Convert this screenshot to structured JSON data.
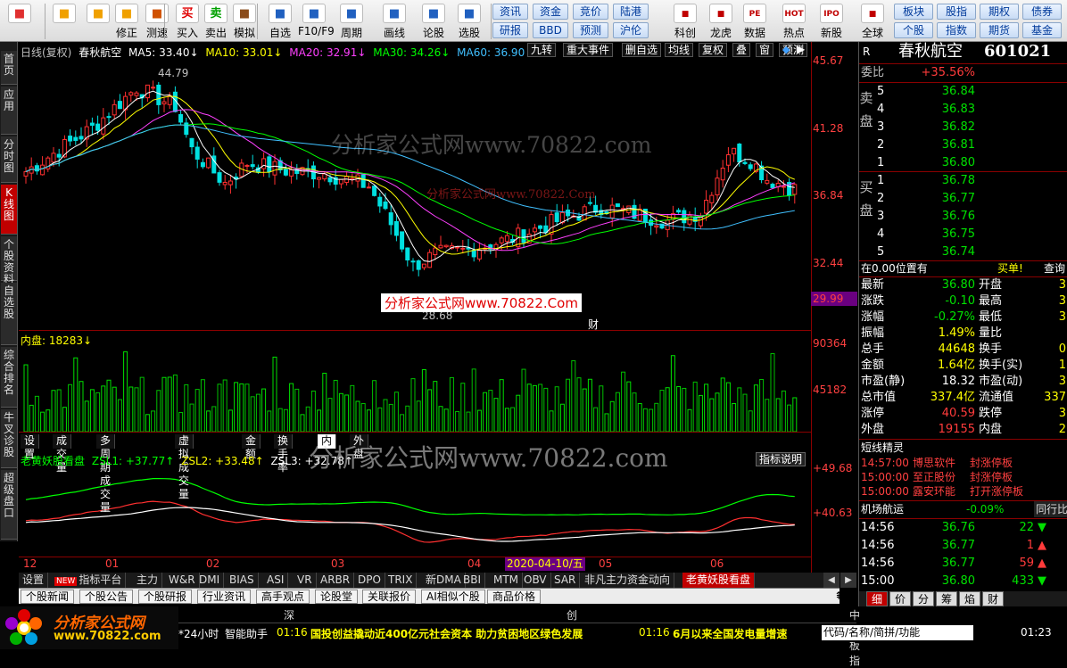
{
  "toolbar": {
    "left_tools": [
      {
        "label": "",
        "icon": "grid-icon"
      },
      {
        "label": "",
        "icon": "back-arrow-icon"
      },
      {
        "label": "",
        "icon": "up-down-arrows-icon"
      },
      {
        "label": "修正",
        "icon": "bell-icon"
      },
      {
        "label": "测速",
        "icon": "clock-icon"
      },
      {
        "label": "买入",
        "icon": "buy-icon",
        "glyph": "买"
      },
      {
        "label": "卖出",
        "icon": "sell-icon",
        "glyph": "卖"
      },
      {
        "label": "模拟",
        "icon": "hammer-icon"
      },
      {
        "label": "自选",
        "icon": "star-icon"
      },
      {
        "label": "F10/F9",
        "icon": "f10-icon"
      },
      {
        "label": "周期",
        "icon": "period-icon"
      },
      {
        "label": "画线",
        "icon": "pencil-icon"
      },
      {
        "label": "论股",
        "icon": "forum-icon"
      },
      {
        "label": "选股",
        "icon": "select-stock-icon"
      }
    ],
    "blue_buttons": [
      [
        "资讯",
        "资金",
        "竞价",
        "陆港"
      ],
      [
        "研报",
        "BBD",
        "预测",
        "沪伦"
      ]
    ],
    "right_tools": [
      {
        "label": "科创",
        "icon": "kechuang-icon"
      },
      {
        "label": "龙虎",
        "icon": "dragon-tiger-icon"
      },
      {
        "label": "数据",
        "icon": "pe-data-icon",
        "glyph": "PE"
      },
      {
        "label": "热点",
        "icon": "hot-icon",
        "glyph": "HOT"
      },
      {
        "label": "新股",
        "icon": "ipo-icon",
        "glyph": "IPO"
      },
      {
        "label": "全球",
        "icon": "globe-icon"
      }
    ],
    "right_buttons": [
      [
        "板块",
        "股指",
        "期权",
        "债券"
      ],
      [
        "个股",
        "指数",
        "期货",
        "基金"
      ]
    ]
  },
  "left_tabs": [
    "首页",
    "应用",
    "分时图",
    "K线图",
    "个股资料",
    "自选股",
    "综合排名",
    "牛叉诊股",
    "超级盘口"
  ],
  "chart": {
    "header": {
      "period": "日线(复权)",
      "name": "春秋航空",
      "ma5": "MA5: 33.40↓",
      "ma10": "MA10: 33.01↓",
      "ma20": "MA20: 32.91↓",
      "ma30": "MA30: 34.26↓",
      "ma60": "MA60: 36.90↓"
    },
    "top_menu": [
      "九转",
      "重大事件",
      "删自选",
      "均线",
      "复权",
      "叠",
      "窗",
      "预测"
    ],
    "price_axis": [
      "45.67",
      "41.28",
      "36.84",
      "32.44",
      "29.99"
    ],
    "high_label": "44.79",
    "low_label": "28.68",
    "event_label": "财",
    "volume": {
      "header": "内盘: 18283↓",
      "axis": [
        "90364",
        "45182"
      ]
    },
    "volume_tabs": [
      "设置",
      "成交量",
      "多周期成交量",
      "虚拟成交量",
      "金额",
      "换手率",
      "内盘",
      "外盘"
    ],
    "indicator": {
      "name": "老黄妖股看盘",
      "zsl1": "ZSL1: +37.77↑",
      "zsl2": "ZSL2: +33.48↑",
      "zsl3": "ZSL3: +32.78↑",
      "help_btn": "指标说明",
      "axis": [
        "+49.68",
        "+40.63"
      ]
    },
    "date_axis": [
      "12",
      "01",
      "02",
      "03",
      "04",
      "05",
      "06"
    ],
    "cursor_date": "2020-04-10/五",
    "watermarks": [
      "分析家公式网www.70822.com",
      "分析家公式网www.70822.Com",
      "分析家公式网www.70822.Com",
      "分析家公式网www.70822.com"
    ]
  },
  "indicator_tabs": [
    {
      "label": "设置",
      "new": false
    },
    {
      "label": "指标平台",
      "new": true
    },
    {
      "label": "主力"
    },
    {
      "label": "W&R"
    },
    {
      "label": "DMI"
    },
    {
      "label": "BIAS"
    },
    {
      "label": "ASI"
    },
    {
      "label": "VR"
    },
    {
      "label": "ARBR"
    },
    {
      "label": "DPO"
    },
    {
      "label": "TRIX"
    },
    {
      "label": "新DMA"
    },
    {
      "label": "BBI"
    },
    {
      "label": "MTM"
    },
    {
      "label": "OBV"
    },
    {
      "label": "SAR"
    },
    {
      "label": "非凡主力资金动向"
    },
    {
      "label": "老黄妖股看盘"
    }
  ],
  "new_badge": "NEW",
  "info_tabs": [
    "个股新闻",
    "个股公告",
    "个股研报",
    "行业资讯",
    "高手观点",
    "论股堂",
    "关联报价",
    "AI相似个股",
    "商品价格"
  ],
  "status": {
    "logo_text": "分析家公式网",
    "logo_url": "www.70822.com",
    "markets": [
      "深",
      "创",
      "中小板指"
    ],
    "ticker_tabs": [
      "*24小时",
      "智能助手"
    ],
    "news1_time": "01:16",
    "news1": "国投创益撬动近400亿元社会资本 助力贫困地区绿色发展",
    "news2_time": "01:16",
    "news2": "6月以来全国发电量增速",
    "search": "代码/名称/简拼/功能",
    "clock": "01:23"
  },
  "right_panel": {
    "r_label": "R",
    "name": "春秋航空",
    "code": "601021",
    "weibi_label": "委比",
    "weibi": "+35.56%",
    "sell_label": "卖盘",
    "buy_label": "买盘",
    "asks": [
      {
        "lvl": "5",
        "price": "36.84",
        "vol": ""
      },
      {
        "lvl": "4",
        "price": "36.83",
        "vol": ""
      },
      {
        "lvl": "3",
        "price": "36.82",
        "vol": ""
      },
      {
        "lvl": "2",
        "price": "36.81",
        "vol": ""
      },
      {
        "lvl": "1",
        "price": "36.80",
        "vol": ""
      }
    ],
    "bids": [
      {
        "lvl": "1",
        "price": "36.78",
        "vol": ""
      },
      {
        "lvl": "2",
        "price": "36.77",
        "vol": ""
      },
      {
        "lvl": "3",
        "price": "36.76",
        "vol": ""
      },
      {
        "lvl": "4",
        "price": "36.75",
        "vol": ""
      },
      {
        "lvl": "5",
        "price": "36.74",
        "vol": ""
      }
    ],
    "position_text": "在0.00位置有",
    "buy_btn": "买单!",
    "query_btn": "查询",
    "stats": [
      {
        "l": "最新",
        "v": "36.80",
        "c": "grn",
        "l2": "开盘",
        "v2": "3"
      },
      {
        "l": "涨跌",
        "v": "-0.10",
        "c": "grn",
        "l2": "最高",
        "v2": "3"
      },
      {
        "l": "涨幅",
        "v": "-0.27%",
        "c": "grn",
        "l2": "最低",
        "v2": "3"
      },
      {
        "l": "振幅",
        "v": "1.49%",
        "c": "yel",
        "l2": "量比",
        "v2": ""
      },
      {
        "l": "总手",
        "v": "44648",
        "c": "yel",
        "l2": "换手",
        "v2": "0"
      },
      {
        "l": "金额",
        "v": "1.64亿",
        "c": "yel",
        "l2": "换手(实)",
        "v2": "1"
      },
      {
        "l": "市盈(静)",
        "v": "18.32",
        "c": "wht",
        "l2": "市盈(动)",
        "v2": "3"
      },
      {
        "l": "总市值",
        "v": "337.4亿",
        "c": "yel",
        "l2": "流通值",
        "v2": "337"
      },
      {
        "l": "涨停",
        "v": "40.59",
        "c": "red",
        "l2": "跌停",
        "v2": "3"
      },
      {
        "l": "外盘",
        "v": "19155",
        "c": "red",
        "l2": "内盘",
        "v2": "2"
      }
    ],
    "duanxian_title": "短线精灵",
    "duanxian": [
      {
        "time": "14:57:00",
        "name": "博思软件",
        "event": "封涨停板"
      },
      {
        "time": "15:00:00",
        "name": "至正股份",
        "event": "封涨停板"
      },
      {
        "time": "15:00:00",
        "name": "露安环能",
        "event": "打开涨停板"
      }
    ],
    "sector_label": "机场航运",
    "sector_change": "-0.09%",
    "sector_btn": "同行比",
    "ticks": [
      {
        "time": "14:56",
        "price": "36.76",
        "vol": "22",
        "dir": "down"
      },
      {
        "time": "14:56",
        "price": "36.77",
        "vol": "1",
        "dir": "up"
      },
      {
        "time": "14:56",
        "price": "36.77",
        "vol": "59",
        "dir": "up"
      },
      {
        "time": "15:00",
        "price": "36.80",
        "vol": "433",
        "dir": "down"
      }
    ],
    "bottom_tabs": [
      "细",
      "价",
      "分",
      "筹",
      "焰",
      "财"
    ]
  }
}
